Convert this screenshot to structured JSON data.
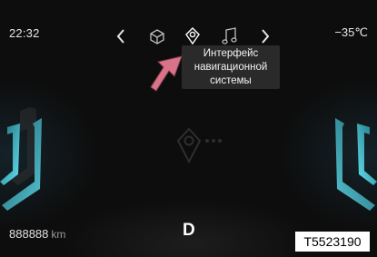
{
  "status": {
    "time": "22:32",
    "temperature": "−35℃"
  },
  "nav": {
    "items": [
      {
        "icon": "chevron-left-icon"
      },
      {
        "icon": "box-icon"
      },
      {
        "icon": "location-pin-icon",
        "active": true
      },
      {
        "icon": "music-note-icon"
      },
      {
        "icon": "chevron-right-icon"
      }
    ]
  },
  "tooltip": {
    "line1": "Интерфейс",
    "line2": "навигационной",
    "line3": "системы"
  },
  "odometer": {
    "value": "888888",
    "unit": "km"
  },
  "gear": "D",
  "figure_code": "T5523190",
  "colors": {
    "background": "#0d0d0d",
    "accent_cyan": "#3fc7d8",
    "pointer_arrow": "#d9738a",
    "tooltip_bg": "#2a2a2a"
  }
}
